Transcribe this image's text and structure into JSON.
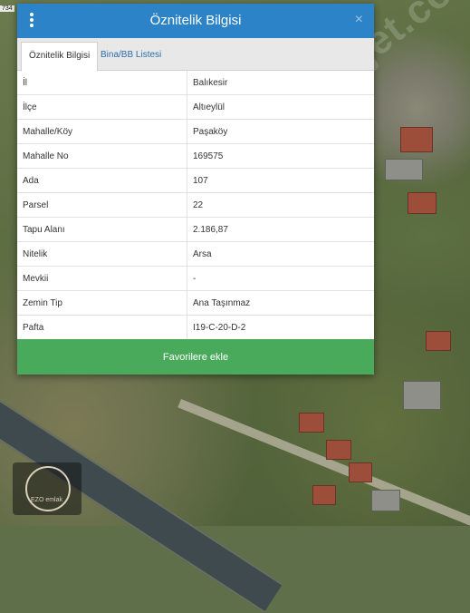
{
  "map": {
    "scale_label": "734",
    "watermark": "sahibindenemlakjet.com",
    "logo_text": "EZO emlak"
  },
  "dialog": {
    "title": "Öznitelik Bilgisi",
    "close_glyph": "×",
    "tabs": [
      {
        "label": "Öznitelik Bilgisi",
        "active": true
      },
      {
        "label": "Bina/BB Listesi",
        "active": false
      }
    ],
    "rows": [
      {
        "key": "İl",
        "value": "Balıkesir"
      },
      {
        "key": "İlçe",
        "value": "Altıeylül"
      },
      {
        "key": "Mahalle/Köy",
        "value": "Paşaköy"
      },
      {
        "key": "Mahalle No",
        "value": "169575"
      },
      {
        "key": "Ada",
        "value": "107"
      },
      {
        "key": "Parsel",
        "value": "22"
      },
      {
        "key": "Tapu Alanı",
        "value": "2.186,87"
      },
      {
        "key": "Nitelik",
        "value": "Arsa"
      },
      {
        "key": "Mevkii",
        "value": "-"
      },
      {
        "key": "Zemin Tip",
        "value": "Ana Taşınmaz"
      },
      {
        "key": "Pafta",
        "value": "I19-C-20-D-2"
      }
    ],
    "favorite_button": "Favorilere ekle"
  },
  "colors": {
    "header": "#2c83c7",
    "favorite_button": "#4aaa5c"
  }
}
